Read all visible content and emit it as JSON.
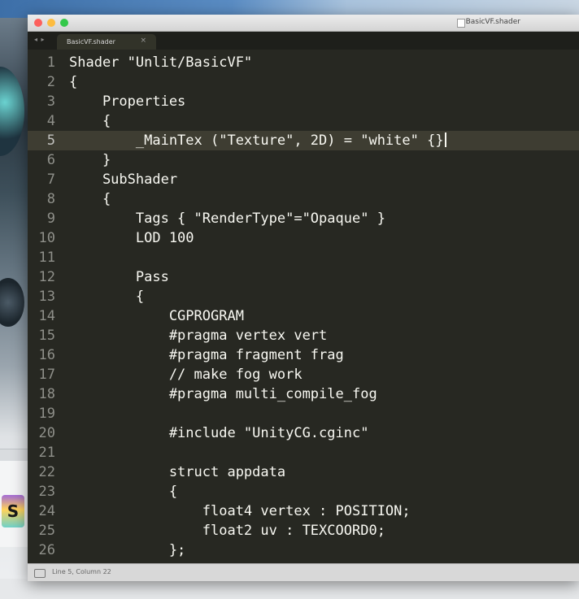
{
  "window": {
    "title": "BasicVF.shader",
    "tab_label": "BasicVF.shader",
    "tab_close": "×",
    "status_text": "Line 5, Column 22"
  },
  "desktop": {
    "mini_label": "S"
  },
  "editor": {
    "current_line": 5,
    "lines": [
      {
        "n": "1",
        "text": "Shader \"Unlit/BasicVF\""
      },
      {
        "n": "2",
        "text": "{"
      },
      {
        "n": "3",
        "text": "    Properties"
      },
      {
        "n": "4",
        "text": "    {"
      },
      {
        "n": "5",
        "text": "        _MainTex (\"Texture\", 2D) = \"white\" {}"
      },
      {
        "n": "6",
        "text": "    }"
      },
      {
        "n": "7",
        "text": "    SubShader"
      },
      {
        "n": "8",
        "text": "    {"
      },
      {
        "n": "9",
        "text": "        Tags { \"RenderType\"=\"Opaque\" }"
      },
      {
        "n": "10",
        "text": "        LOD 100"
      },
      {
        "n": "11",
        "text": ""
      },
      {
        "n": "12",
        "text": "        Pass"
      },
      {
        "n": "13",
        "text": "        {"
      },
      {
        "n": "14",
        "text": "            CGPROGRAM"
      },
      {
        "n": "15",
        "text": "            #pragma vertex vert"
      },
      {
        "n": "16",
        "text": "            #pragma fragment frag"
      },
      {
        "n": "17",
        "text": "            // make fog work"
      },
      {
        "n": "18",
        "text": "            #pragma multi_compile_fog"
      },
      {
        "n": "19",
        "text": ""
      },
      {
        "n": "20",
        "text": "            #include \"UnityCG.cginc\""
      },
      {
        "n": "21",
        "text": ""
      },
      {
        "n": "22",
        "text": "            struct appdata"
      },
      {
        "n": "23",
        "text": "            {"
      },
      {
        "n": "24",
        "text": "                float4 vertex : POSITION;"
      },
      {
        "n": "25",
        "text": "                float2 uv : TEXCOORD0;"
      },
      {
        "n": "26",
        "text": "            };"
      }
    ]
  },
  "colors": {
    "editor_bg": "#272822",
    "text": "#f8f8f2",
    "line_number": "#8f908a",
    "current_line_bg": "#3e3d32"
  }
}
